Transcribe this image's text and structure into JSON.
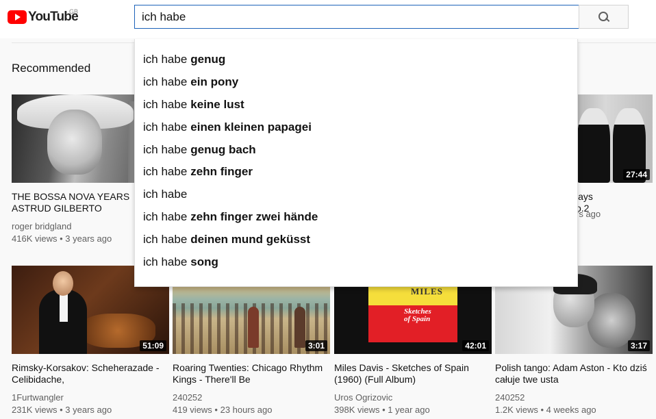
{
  "header": {
    "logo_text": "YouTube",
    "region": "GB",
    "search_value": "ich habe"
  },
  "section": {
    "title": "Recommended"
  },
  "suggestions": [
    {
      "base": "ich habe",
      "completion": "genug"
    },
    {
      "base": "ich habe",
      "completion": "ein pony"
    },
    {
      "base": "ich habe",
      "completion": "keine lust"
    },
    {
      "base": "ich habe",
      "completion": "einen kleinen papagei"
    },
    {
      "base": "ich habe",
      "completion": "genug bach"
    },
    {
      "base": "ich habe",
      "completion": "zehn finger"
    },
    {
      "base": "ich habe",
      "completion": ""
    },
    {
      "base": "ich habe",
      "completion": "zehn finger zwei hände"
    },
    {
      "base": "ich habe",
      "completion": "deinen mund geküsst"
    },
    {
      "base": "ich habe",
      "completion": "song"
    }
  ],
  "videos_row1": [
    {
      "title": "THE BOSSA NOVA YEARS ASTRUD GILBERTO",
      "channel": "roger bridgland",
      "views": "416K views",
      "age": "3 years ago",
      "duration": ""
    },
    {
      "title": "",
      "channel": "",
      "views": "",
      "age": "",
      "duration": ""
    },
    {
      "title": "",
      "channel": "",
      "views": "",
      "age": "",
      "duration": ""
    },
    {
      "title": "lays\no.2",
      "channel": "",
      "views": "",
      "age": "rs ago",
      "duration": "27:44"
    }
  ],
  "videos_row2": [
    {
      "title": "Rimsky-Korsakov: Scheherazade - Celibidache,",
      "channel": "1Furtwangler",
      "views": "231K views",
      "age": "3 years ago",
      "duration": "51:09"
    },
    {
      "title": "Roaring Twenties: Chicago Rhythm Kings - There'll Be",
      "channel": "240252",
      "views": "419 views",
      "age": "23 hours ago",
      "duration": "3:01"
    },
    {
      "title": "Miles Davis - Sketches of Spain (1960) (Full Album)",
      "channel": "Uros Ogrizovic",
      "views": "398K views",
      "age": "1 year ago",
      "duration": "42:01"
    },
    {
      "title": "Polish tango: Adam Aston - Kto dziś całuje twe usta",
      "channel": "240252",
      "views": "1.2K views",
      "age": "4 weeks ago",
      "duration": "3:17"
    }
  ],
  "miles_poster": {
    "line1": "MILES",
    "line2": "Sketches",
    "line3": "of Spain"
  },
  "colors": {
    "brand_red": "#ff0000",
    "search_border": "#1c62b9",
    "meta_gray": "#606060"
  }
}
